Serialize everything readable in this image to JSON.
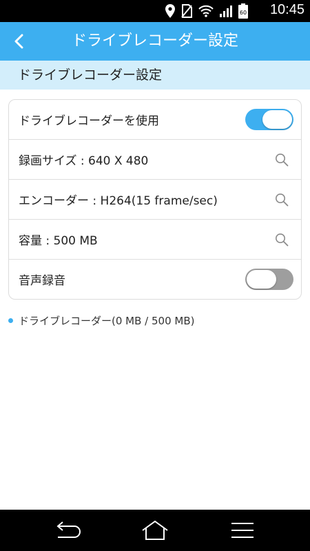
{
  "status_bar": {
    "time": "10:45",
    "signal_sub": "60",
    "icons": [
      "location-icon",
      "no-sim-icon",
      "wifi-icon",
      "signal-icon",
      "battery-icon"
    ]
  },
  "app_bar": {
    "title": "ドライブレコーダー設定",
    "back_icon": "chevron-left-icon",
    "color": "#3daff0"
  },
  "section": {
    "title": "ドライブレコーダー設定",
    "background": "#d3eefb"
  },
  "settings": {
    "use_recorder": {
      "label": "ドライブレコーダーを使用",
      "enabled": true
    },
    "record_size": {
      "label": "録画サイズ : 640 X 480"
    },
    "encoder": {
      "label": "エンコーダー : H264(15 frame/sec)"
    },
    "capacity": {
      "label": "容量 : 500 MB"
    },
    "audio_record": {
      "label": "音声録音",
      "enabled": false
    }
  },
  "storage_info": {
    "text": "ドライブレコーダー(0 MB / 500 MB)"
  },
  "nav_bar": {
    "icons": [
      "back-icon",
      "home-icon",
      "menu-icon"
    ]
  }
}
